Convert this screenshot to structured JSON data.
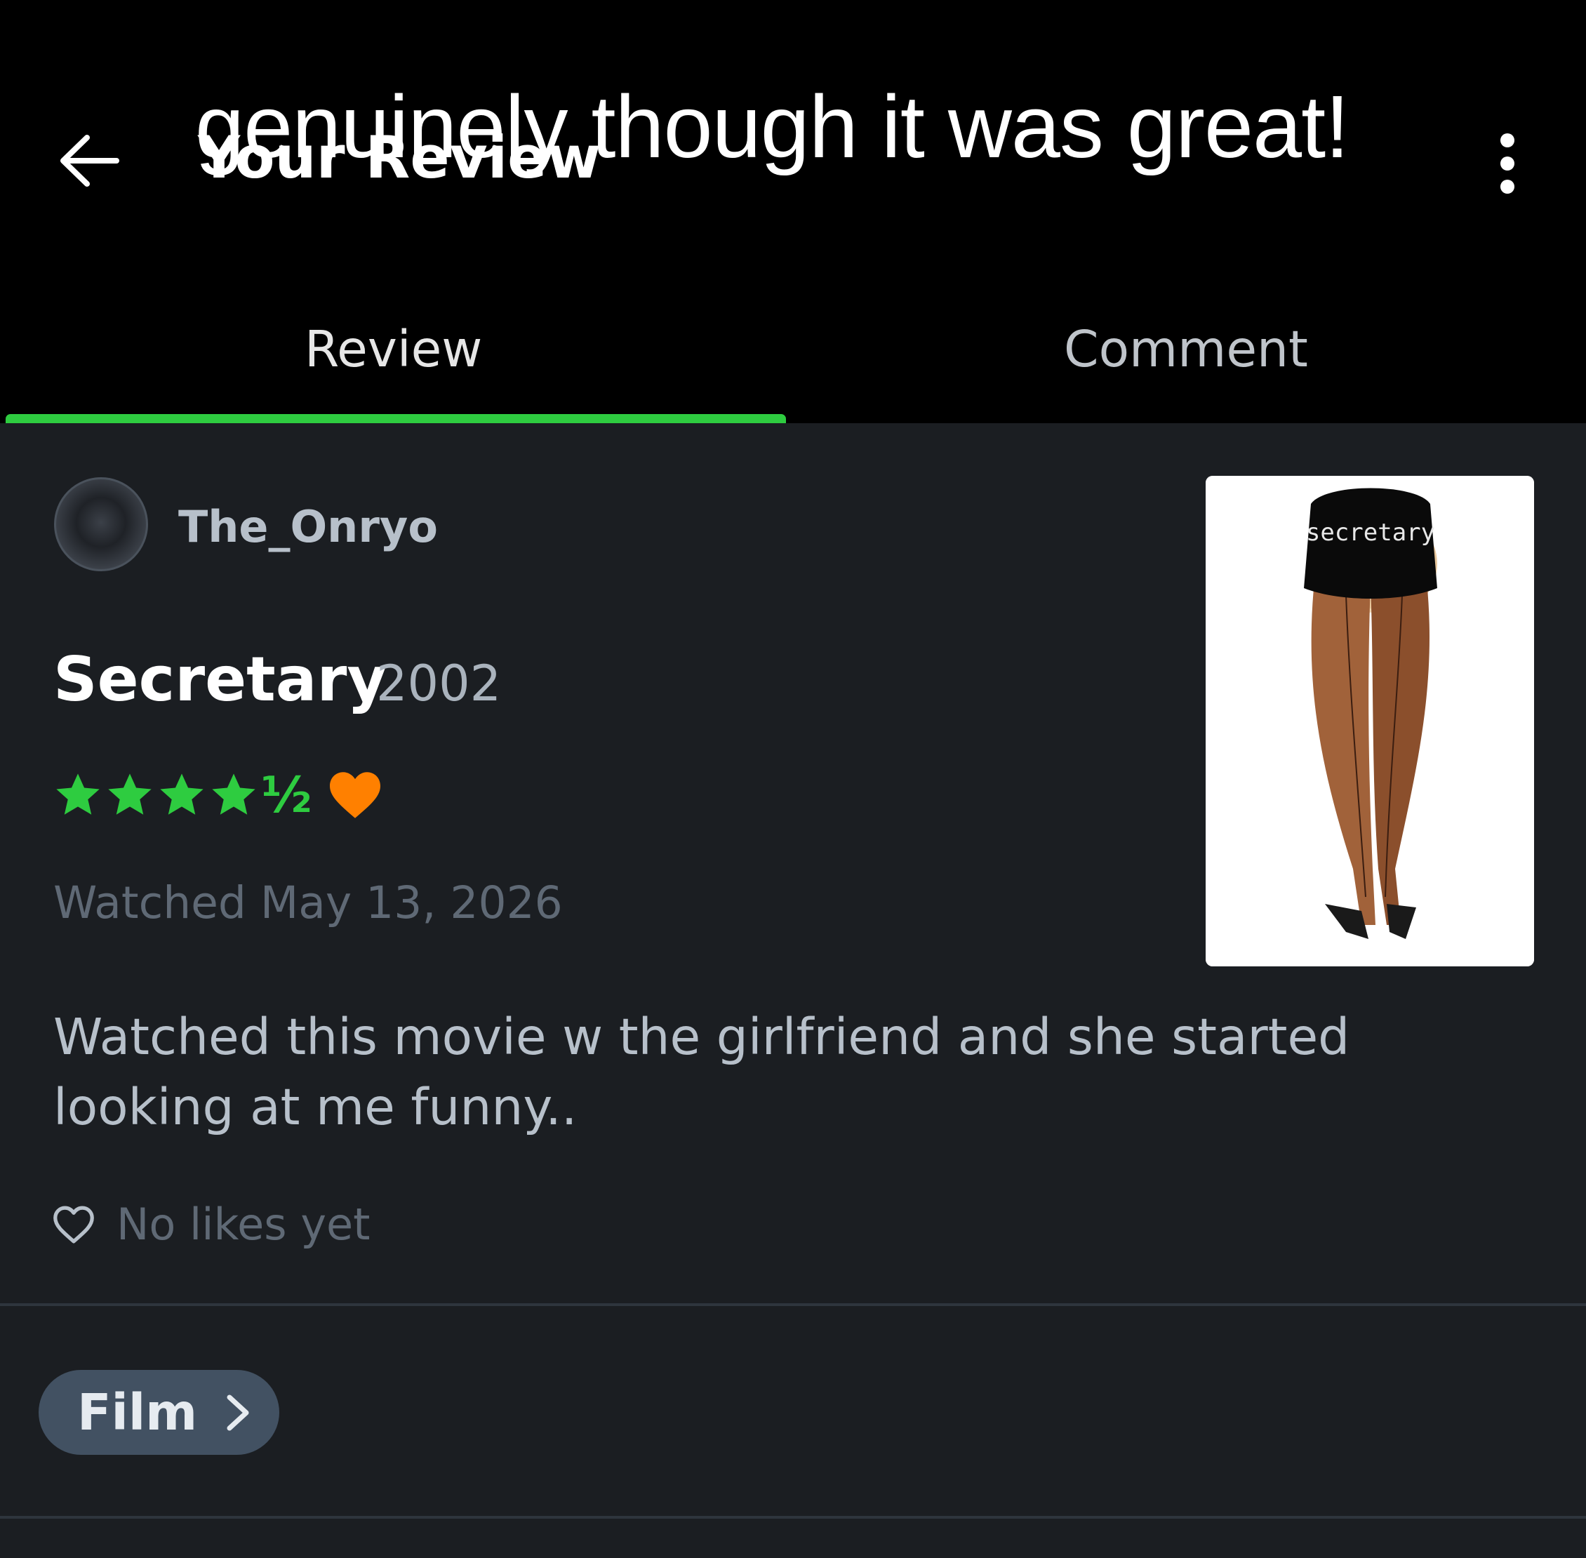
{
  "header": {
    "title": "Your Review",
    "overlay_caption": "genuinely though it was great!"
  },
  "tabs": [
    {
      "label": "Review",
      "active": true
    },
    {
      "label": "Comment",
      "active": false
    }
  ],
  "review": {
    "username": "The_Onryo",
    "film_title": "Secretary",
    "film_year": "2002",
    "rating_stars": 4.5,
    "half_star": "½",
    "liked": true,
    "watched": "Watched May 13, 2026",
    "text": "Watched this movie w the girlfriend and she started looking at me funny..",
    "likes_text": "No likes yet",
    "poster_caption": "secretary"
  },
  "chip": {
    "label": "Film"
  },
  "colors": {
    "accent_green": "#2ecc40",
    "heart_orange": "#ff8000",
    "chip_bg": "#425162",
    "background": "#1b1e22",
    "header_bg": "#000000"
  },
  "icons": {
    "back": "arrow-left-icon",
    "more": "more-vertical-icon",
    "star": "star-icon",
    "heart_filled": "heart-icon",
    "heart_outline": "heart-outline-icon",
    "chevron": "chevron-right-icon"
  }
}
